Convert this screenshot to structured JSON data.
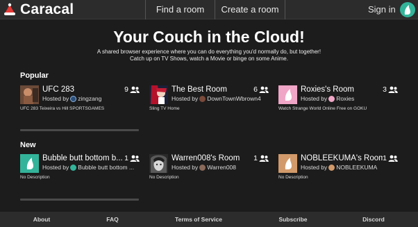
{
  "header": {
    "logo_text": "Caracal",
    "nav": [
      "Find a room",
      "Create a room"
    ],
    "signin_label": "Sign in"
  },
  "hero": {
    "title": "Your Couch in the Cloud!",
    "subtitle_line1": "A shared browser experience where you can do everything you'd normally do, but together!",
    "subtitle_line2": "Catch up on TV Shows, watch a Movie or binge on some Anime."
  },
  "sections": {
    "popular": {
      "title": "Popular",
      "rooms": [
        {
          "title": "UFC 283",
          "hosted_by": "Hosted by",
          "host": "zingzang",
          "count": "9",
          "description": "UFC 283 Teixeira vs Hill SPORTSGAMES"
        },
        {
          "title": "The Best Room",
          "hosted_by": "Hosted by",
          "host": "DownTownWbrown4",
          "count": "6",
          "description": "Sling TV Home"
        },
        {
          "title": "Roxies's Room",
          "hosted_by": "Hosted by",
          "host": "Roxies",
          "count": "3",
          "description": "Watch Strange World Online Free on GOKU"
        }
      ]
    },
    "new": {
      "title": "New",
      "rooms": [
        {
          "title": "Bubble butt bottom b...",
          "hosted_by": "Hosted by",
          "host": "Bubble butt bottom ...",
          "count": "1",
          "description": "No Description"
        },
        {
          "title": "Warren008's Room",
          "hosted_by": "Hosted by",
          "host": "Warren008",
          "count": "1",
          "description": "No Description"
        },
        {
          "title": "NOBLEEKUMA's Room",
          "hosted_by": "Hosted by",
          "host": "NOBLEEKUMA",
          "count": "1",
          "description": "No Description"
        }
      ]
    }
  },
  "footer": {
    "links": [
      "About",
      "FAQ",
      "Terms of Service",
      "Subscribe",
      "Discord"
    ]
  },
  "colors": {
    "brand_teal": "#33b49a",
    "pink_thumb": "#f0a6c6",
    "tan_thumb": "#d29a6a",
    "background": "#1c1c1c"
  },
  "icons": {
    "logo": "caracal-santa-hat-icon",
    "users": "users-icon",
    "user_avatar": "caracal-avatar-icon"
  }
}
